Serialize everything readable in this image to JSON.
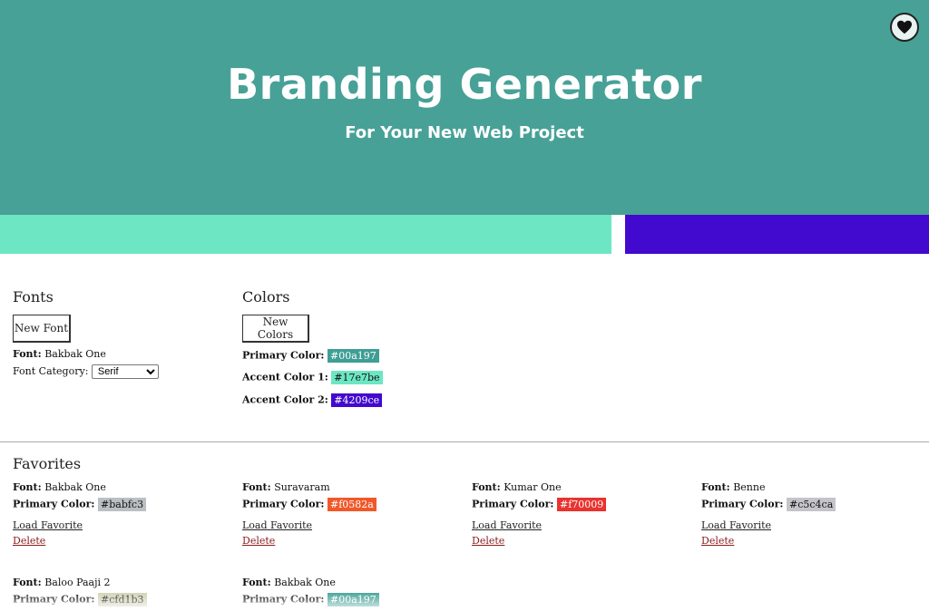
{
  "header": {
    "title": "Branding Generator",
    "subtitle": "For Your New Web Project",
    "favorites_icon": "heart-icon",
    "band_colors": [
      "#6de6c4",
      "#4209ce"
    ]
  },
  "fonts": {
    "title": "Fonts",
    "new_button": "New Font",
    "font_label": "Font:",
    "font_value": "Bakbak One",
    "category_label": "Font Category:",
    "category_value": "Serif"
  },
  "colors": {
    "title": "Colors",
    "new_button": "New Colors",
    "primary_label": "Primary Color:",
    "primary_value": "#00a197",
    "accent1_label": "Accent Color 1:",
    "accent1_value": "#17e7be",
    "accent2_label": "Accent Color 2:",
    "accent2_value": "#4209ce"
  },
  "favorites": {
    "title": "Favorites",
    "font_label": "Font:",
    "primary_label": "Primary Color:",
    "load_label": "Load Favorite",
    "delete_label": "Delete",
    "items": [
      {
        "font": "Bakbak One",
        "primary": "#babfc3",
        "chip_color": "#babfc3"
      },
      {
        "font": "Suravaram",
        "primary": "#f0582a",
        "chip_color": "#f0582a"
      },
      {
        "font": "Kumar One",
        "primary": "#f70009",
        "chip_color": "#e8332f"
      },
      {
        "font": "Benne",
        "primary": "#c5c4ca",
        "chip_color": "#c5c4ca"
      },
      {
        "font": "Baloo Paaji 2",
        "primary": "#cfd1b3",
        "chip_color": "#cfd1b3"
      },
      {
        "font": "Bakbak One",
        "primary": "#00a197",
        "chip_color": "#3f9e95"
      }
    ]
  }
}
